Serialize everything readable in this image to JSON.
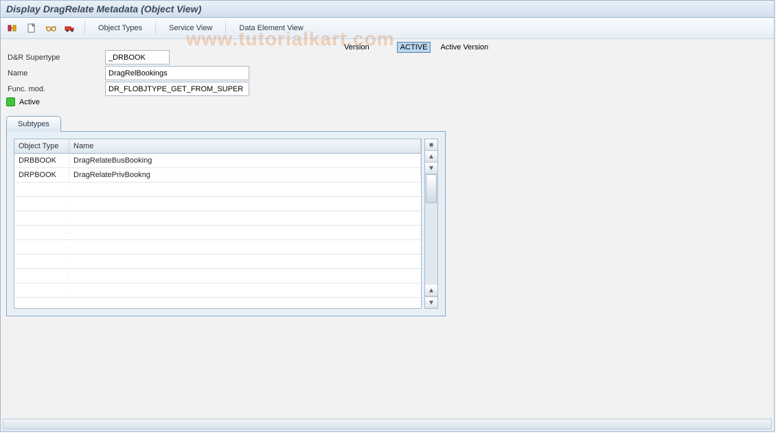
{
  "title": "Display DragRelate Metadata (Object View)",
  "toolbar": {
    "btn_toggle_icon": "toggle",
    "btn_new_icon": "new",
    "btn_glasses_icon": "display",
    "btn_transport_icon": "transport",
    "link_object_types": "Object Types",
    "link_service_view": "Service View",
    "link_data_element_view": "Data Element View"
  },
  "version": {
    "label": "Version",
    "value": "ACTIVE",
    "desc": "Active Version"
  },
  "fields": {
    "supertype_label": "D&R Supertype",
    "supertype_value": "_DRBOOK",
    "name_label": "Name",
    "name_value": "DragRelBookings",
    "funcmod_label": "Func. mod.",
    "funcmod_value": "DR_FLOBJTYPE_GET_FROM_SUPER",
    "active_label": "Active"
  },
  "tab": {
    "label": "Subtypes",
    "columns": {
      "type": "Object Type",
      "name": "Name"
    },
    "rows": [
      {
        "type": "DRBBOOK",
        "name": "DragRelateBusBooking"
      },
      {
        "type": "DRPBOOK",
        "name": "DragRelatePrivBookng"
      }
    ]
  },
  "watermark": "www.tutorialkart.com"
}
